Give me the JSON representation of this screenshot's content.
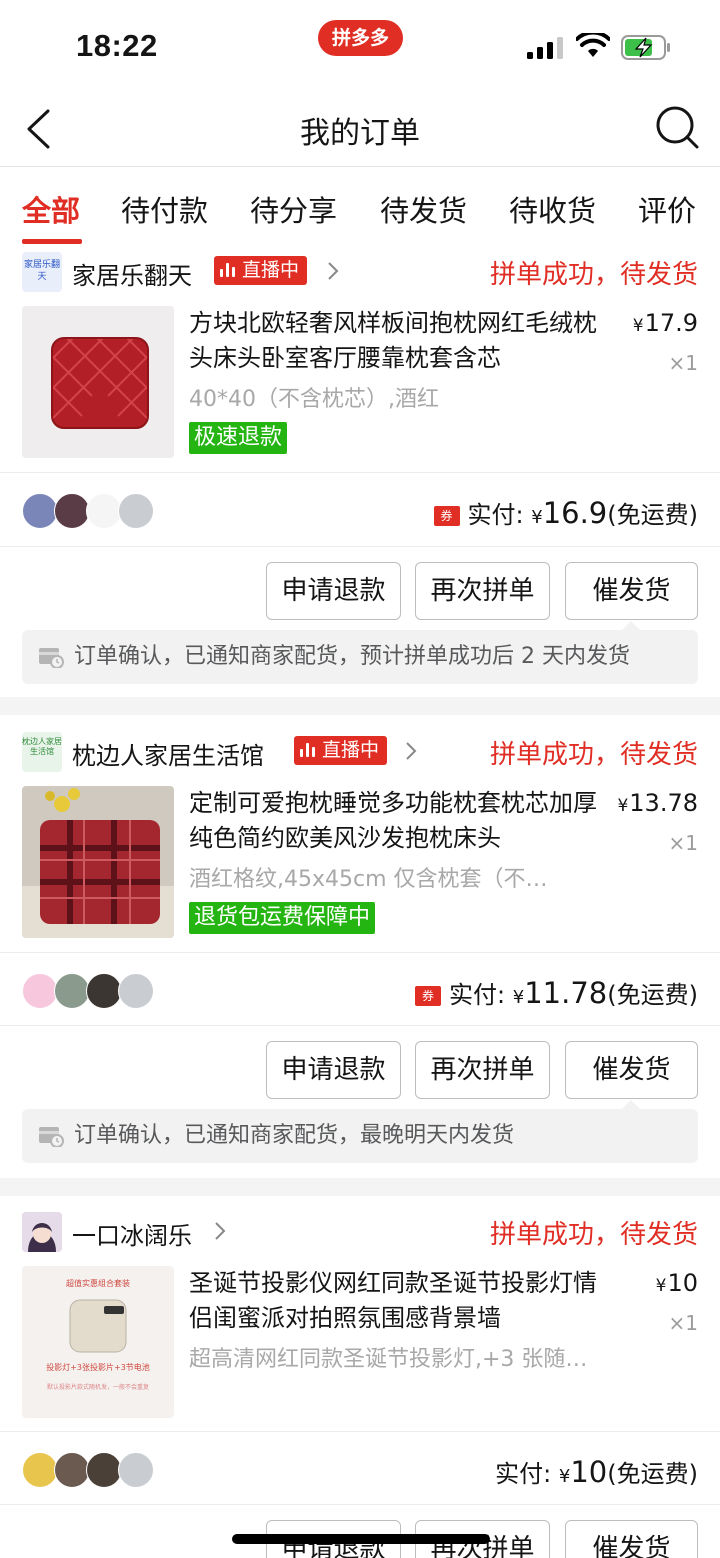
{
  "status_bar": {
    "time": "18:22",
    "app_badge": "拼多多"
  },
  "nav": {
    "title": "我的订单"
  },
  "tabs": [
    {
      "label": "全部",
      "active": true
    },
    {
      "label": "待付款"
    },
    {
      "label": "待分享"
    },
    {
      "label": "待发货"
    },
    {
      "label": "待收货"
    },
    {
      "label": "评价"
    }
  ],
  "orders": [
    {
      "shop_logo": "家居乐翻天",
      "shop_name": "家居乐翻天",
      "live_label": "直播中",
      "status": "拼单成功，待发货",
      "title": "方块北欧轻奢风样板间抱枕网红毛绒枕头床头卧室客厅腰靠枕套含芯",
      "price_symbol": "¥",
      "price": "17.9",
      "qty": "×1",
      "spec": "40*40（不含枕芯）,酒红",
      "guarantee": "极速退款",
      "coupon": "券",
      "paid_label": "实付:",
      "paid_symbol": "¥",
      "paid_amount": "16.9",
      "shipping": "(免运费)",
      "buttons": [
        "申请退款",
        "再次拼单",
        "催发货"
      ],
      "notice": "订单确认，已通知商家配货，预计拼单成功后 2 天内发货"
    },
    {
      "shop_logo": "枕边人家居生活馆",
      "shop_name": "枕边人家居生活馆",
      "live_label": "直播中",
      "status": "拼单成功，待发货",
      "title": "定制可爱抱枕睡觉多功能枕套枕芯加厚纯色简约欧美风沙发抱枕床头",
      "price_symbol": "¥",
      "price": "13.78",
      "qty": "×1",
      "spec": "酒红格纹,45x45cm 仅含枕套（不…",
      "guarantee": "退货包运费保障中",
      "coupon": "券",
      "paid_label": "实付:",
      "paid_symbol": "¥",
      "paid_amount": "11.78",
      "shipping": "(免运费)",
      "buttons": [
        "申请退款",
        "再次拼单",
        "催发货"
      ],
      "notice": "订单确认，已通知商家配货，最晚明天内发货"
    },
    {
      "shop_name": "一口冰阔乐",
      "status": "拼单成功，待发货",
      "title": "圣诞节投影仪网红同款圣诞节投影灯情侣闺蜜派对拍照氛围感背景墙",
      "price_symbol": "¥",
      "price": "10",
      "qty": "×1",
      "spec": "超高清网红同款圣诞节投影灯,+3 张随…",
      "thumb_top": "超值实惠组合套装",
      "thumb_mid": "投影灯+3张投影片+3节电池",
      "thumb_small": "默认投影片款式随机发，一般不会重复",
      "paid_label": "实付:",
      "paid_symbol": "¥",
      "paid_amount": "10",
      "shipping": "(免运费)",
      "buttons": [
        "申请退款",
        "再次拼单",
        "催发货"
      ]
    }
  ],
  "colors": {
    "brand_red": "#e02e24",
    "guarantee_green": "#25b513"
  }
}
